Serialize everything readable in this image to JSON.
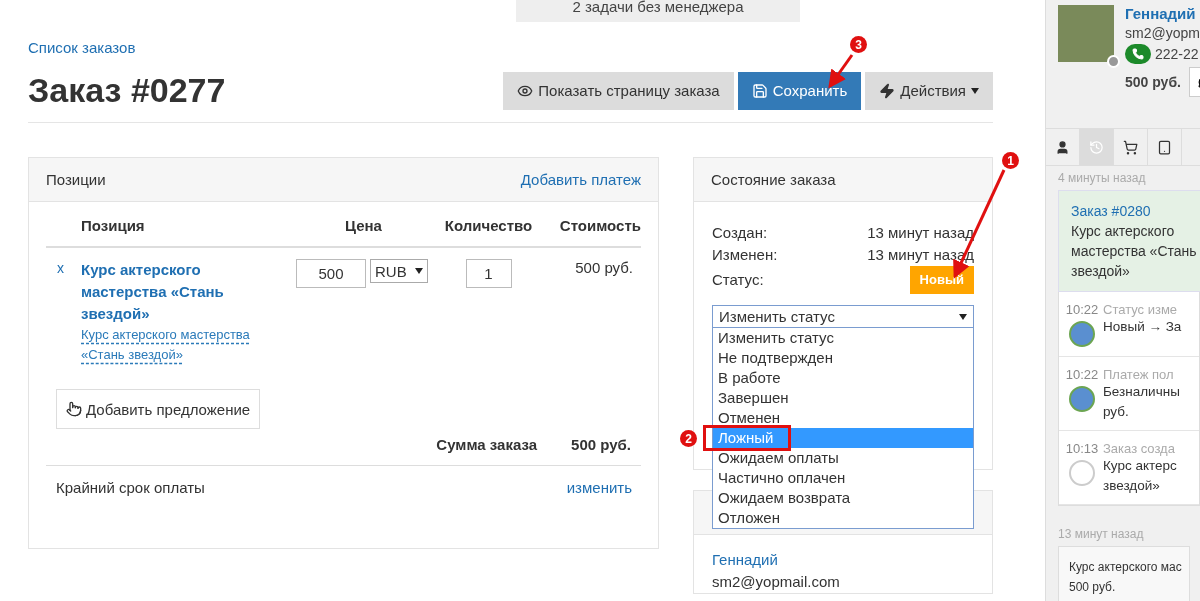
{
  "top_banner": "2 задачи без менеджера",
  "breadcrumb": "Список заказов",
  "title": "Заказ #0277",
  "actions": [
    {
      "kind": "view",
      "label": "Показать страницу заказа"
    },
    {
      "kind": "save",
      "label": "Сохранить"
    },
    {
      "kind": "menu",
      "label": "Действия"
    }
  ],
  "positions": {
    "title": "Позиции",
    "add_payment": "Добавить платеж",
    "columns": [
      "Позиция",
      "Цена",
      "Количество",
      "Стоимость"
    ],
    "rows": [
      {
        "remove": "x",
        "name": "Курс актерского мастерства «Стань звездой»",
        "variant": "Курс актерского мастерства «Стань звездой»",
        "price": "500",
        "currency": "RUB",
        "quantity": "1",
        "cost": "500 руб."
      }
    ],
    "add_offer": "Добавить предложение",
    "total_label": "Сумма заказа",
    "total": "500 руб.",
    "deadline_label": "Крайний срок оплаты",
    "deadline_action": "изменить"
  },
  "order_state": {
    "title": "Состояние заказа",
    "fields": [
      {
        "label": "Создан:",
        "value": "13 минут назад"
      },
      {
        "label": "Изменен:",
        "value": "13 минут назад"
      }
    ],
    "status_label": "Статус:",
    "status": "Новый",
    "status_select": "Изменить статус",
    "status_options": [
      {
        "label": "Изменить статус",
        "selected": false
      },
      {
        "label": "Не подтвержден",
        "selected": false
      },
      {
        "label": "В работе",
        "selected": false
      },
      {
        "label": "Завершен",
        "selected": false
      },
      {
        "label": "Отменен",
        "selected": false
      },
      {
        "label": "Ложный",
        "selected": true
      },
      {
        "label": "Ожидаем оплаты",
        "selected": false
      },
      {
        "label": "Частично оплачен",
        "selected": false
      },
      {
        "label": "Ожидаем возврата",
        "selected": false
      },
      {
        "label": "Отложен",
        "selected": false
      }
    ]
  },
  "customer": {
    "name": "Геннадий",
    "email": "sm2@yopmail.com"
  },
  "sidebar": {
    "name": "Геннадий",
    "email": "sm2@yopm",
    "phone": "222-22",
    "balance": "500 руб.",
    "tabs": [
      {
        "kind": "user",
        "selected": false
      },
      {
        "kind": "history",
        "selected": true
      },
      {
        "kind": "cart",
        "selected": false
      },
      {
        "kind": "device",
        "selected": false
      }
    ],
    "groups": [
      {
        "time_ago": "4 минуты назад",
        "order_link": "Заказ #0280",
        "order_text": "Курс актерского мастерства «Стань звездой»",
        "events": [
          {
            "time": "10:22",
            "kind": "photo",
            "title": "Статус изме",
            "text": "Новый → За"
          },
          {
            "time": "10:22",
            "kind": "photo",
            "title": "Платеж пол",
            "text": "Безналичны руб."
          },
          {
            "time": "10:13",
            "kind": "default",
            "title": "Заказ созда",
            "text": "Курс актерс звездой»"
          }
        ]
      },
      {
        "time_ago": "13 минут назад",
        "note": "Курс актерского мас 500 руб."
      }
    ]
  },
  "annotations": [
    {
      "number": "1"
    },
    {
      "number": "2"
    },
    {
      "number": "3"
    }
  ]
}
